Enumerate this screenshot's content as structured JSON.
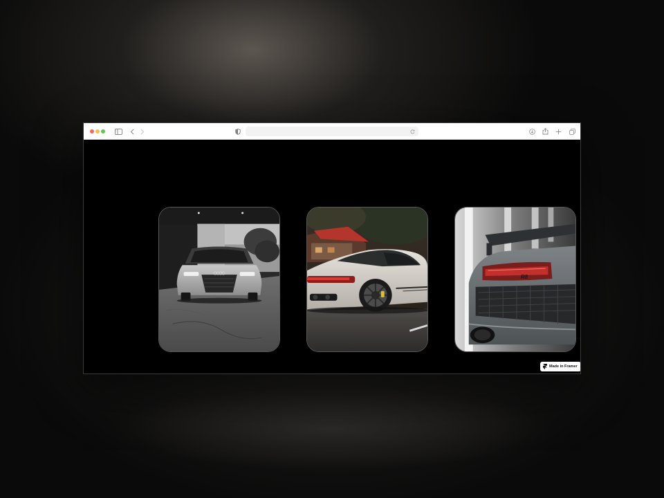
{
  "browser": {
    "address_text": "",
    "icons": {
      "sidebar": "sidebar-icon",
      "back": "chevron-left-icon",
      "forward": "chevron-right-icon",
      "privacy": "shield-icon",
      "reload": "reload-icon",
      "download": "download-icon",
      "share": "share-icon",
      "new_tab": "plus-icon",
      "tabs": "tabs-overview-icon"
    }
  },
  "gallery": {
    "cards": [
      {
        "subject": "gray Audi sedan front view in garage"
      },
      {
        "subject": "white Porsche 911 rear three-quarter view"
      },
      {
        "subject": "gray Audi R8 rear detail"
      }
    ]
  },
  "badge": {
    "label": "Made in Framer",
    "icon": "framer-logo-icon"
  },
  "colors": {
    "page_background": "#080808",
    "toolbar": "#ffffff",
    "viewport": "#000000",
    "traffic_red": "#ee6a5e",
    "traffic_yellow": "#f5bf4f",
    "traffic_green": "#61c554"
  }
}
